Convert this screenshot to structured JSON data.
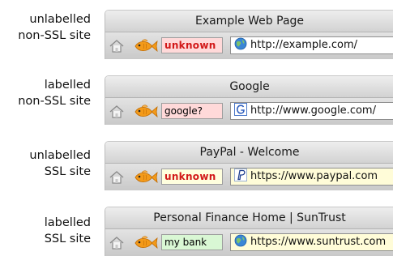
{
  "examples": [
    {
      "caption": [
        "unlabelled",
        "non-SSL site"
      ],
      "window_title": "Example Web Page",
      "petname": "unknown",
      "petname_state": "untrusted",
      "petname_alert": true,
      "site_icon": "globe-icon",
      "url": "http://example.com/",
      "secure": false
    },
    {
      "caption": [
        "labelled",
        "non-SSL site"
      ],
      "window_title": "Google",
      "petname": "google?",
      "petname_state": "untrusted",
      "petname_alert": false,
      "site_icon": "google-favicon-icon",
      "url": "http://www.google.com/",
      "secure": false
    },
    {
      "caption": [
        "unlabelled",
        "SSL site"
      ],
      "window_title": "PayPal - Welcome",
      "petname": "unknown",
      "petname_state": "warning",
      "petname_alert": true,
      "site_icon": "paypal-favicon-icon",
      "url": "https://www.paypal.com",
      "secure": true
    },
    {
      "caption": [
        "labelled",
        "SSL site"
      ],
      "window_title": "Personal Finance Home | SunTrust",
      "petname": "my bank",
      "petname_state": "trusted",
      "petname_alert": false,
      "site_icon": "globe-icon",
      "url": "https://www.suntrust.com",
      "secure": true
    }
  ],
  "colors": {
    "untrusted_bg": "#ffd9d9",
    "warning_bg": "#ffffde",
    "trusted_bg": "#d9f7d4",
    "alert_text": "#d21818",
    "fish": "#f39a1a"
  }
}
